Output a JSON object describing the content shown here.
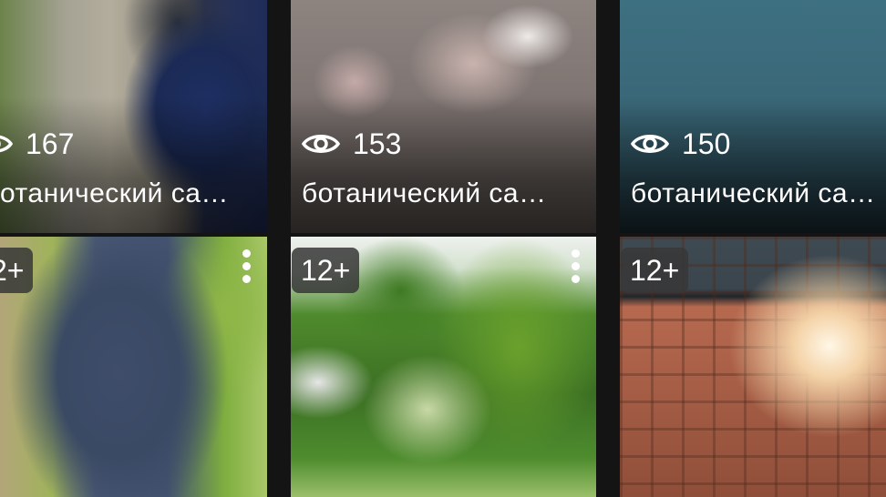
{
  "tiles_top": [
    {
      "views": "167",
      "title": "отанический са…"
    },
    {
      "views": "153",
      "title": "ботанический са…"
    },
    {
      "views": "150",
      "title": "ботанический са…"
    }
  ],
  "tiles_bottom": [
    {
      "age": "2+"
    },
    {
      "age": "12+"
    },
    {
      "age": "12+"
    }
  ],
  "icons": {
    "views": "eye-icon",
    "menu": "more-vertical-icon"
  }
}
